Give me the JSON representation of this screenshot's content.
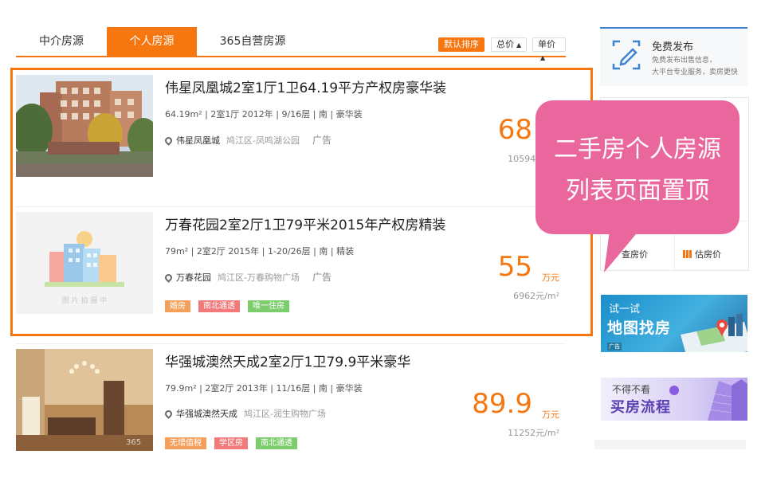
{
  "tabs": [
    {
      "label": "中介房源",
      "active": false
    },
    {
      "label": "个人房源",
      "active": true
    },
    {
      "label": "365自营房源",
      "active": false
    }
  ],
  "sort": {
    "default_label": "默认排序",
    "total_label": "总价",
    "unit_label": "单价",
    "caret": "▲"
  },
  "listings": [
    {
      "title": "伟星凤凰城2室1厅1卫64.19平方产权房豪华装",
      "meta": "64.19m² | 2室1厅    2012年 | 9/16层 | 南 | 豪华装",
      "community": "伟星凤凰城",
      "area": "鸠江区-凤鸣湖公园",
      "ad_label": "广告",
      "tags": [],
      "price": "68",
      "price_unit": "万元",
      "unit_price": "10594元/m²",
      "thumb": "building-photo"
    },
    {
      "title": "万春花园2室2厅1卫79平米2015年产权房精装",
      "meta": "79m² | 2室2厅    2015年 | 1-20/26层 | 南 | 精装",
      "community": "万春花园",
      "area": "鸠江区-万春购物广场",
      "ad_label": "广告",
      "tags": [
        {
          "label": "婚房",
          "color": "o"
        },
        {
          "label": "南北通透",
          "color": "r"
        },
        {
          "label": "唯一住房",
          "color": "g"
        }
      ],
      "price": "55",
      "price_unit": "万元",
      "unit_price": "6962元/m²",
      "thumb": "placeholder-illustration",
      "thumb_caption": "图 片 拍 摄 中"
    },
    {
      "title": "华强城澳然天成2室2厅1卫79.9平米豪华",
      "meta": "79.9m² | 2室2厅    2013年 | 11/16层 | 南 | 豪华装",
      "community": "华强城澳然天成",
      "area": "鸠江区-润生购物广场",
      "ad_label": "",
      "tags": [
        {
          "label": "无增值税",
          "color": "o"
        },
        {
          "label": "学区房",
          "color": "r"
        },
        {
          "label": "南北通透",
          "color": "g"
        }
      ],
      "price": "89.9",
      "price_unit": "万元",
      "unit_price": "11252元/m²",
      "thumb": "interior-photo",
      "thumb_watermark": "365"
    }
  ],
  "sidebar": {
    "publish": {
      "title": "免费发布",
      "desc1": "免费发布出售信息，",
      "desc2": "大平台专业服务，卖房更快"
    },
    "check_price_label": "查房价",
    "estimate_price_label": "估房价",
    "map_banner": {
      "line1": "试一试",
      "line2": "地图找房",
      "mark": "广告"
    },
    "flow_banner": {
      "line1": "不得不看",
      "line2": "买房流程"
    }
  },
  "callout": {
    "line1": "二手房个人房源",
    "line2": "列表页面置顶"
  },
  "colors": {
    "accent": "#f6760f",
    "callout": "#e9679c",
    "sidebar_top": "#3e84d0"
  }
}
